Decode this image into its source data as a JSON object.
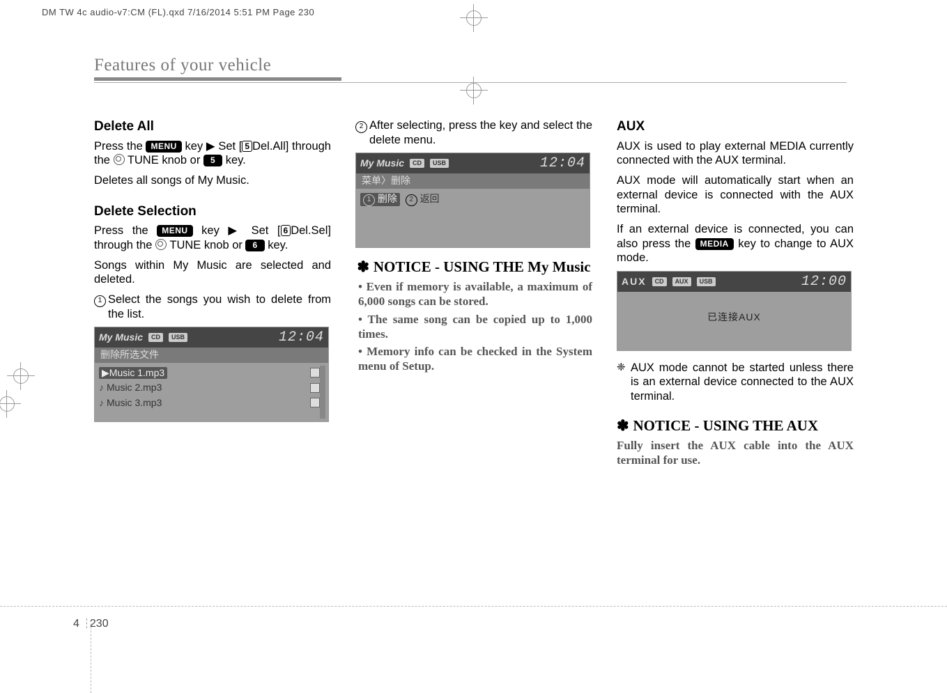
{
  "meta": {
    "print_header": "DM TW 4c audio-v7:CM (FL).qxd  7/16/2014  5:51 PM  Page 230"
  },
  "chapter_title": "Features of your vehicle",
  "footer": {
    "section": "4",
    "page": "230"
  },
  "col1": {
    "h_delete_all": "Delete All",
    "delete_all_1a": "Press the ",
    "key_menu": "MENU",
    "delete_all_1b": " key ▶ Set [",
    "box5": "5",
    "delete_all_1c": "Del.All] through the ",
    "tune": " TUNE knob or ",
    "keynum5": "5",
    "delete_all_1d": " key.",
    "delete_all_2": "Deletes all songs of My Music.",
    "h_delete_sel": "Delete Selection",
    "delete_sel_1a": "Press the ",
    "delete_sel_1b": " key ▶ Set [",
    "box6": "6",
    "delete_sel_1c": "Del.Sel] through the ",
    "keynum6": "6",
    "delete_sel_1d": " key.",
    "delete_sel_2": "Songs within My Music are selected and deleted.",
    "step1_num": "1",
    "step1": "Select the songs you wish to delete from the list.",
    "lcd_title": "My Music",
    "lcd_time": "12:04",
    "lcd_cd": "CD",
    "lcd_usb": "USB",
    "lcd_sub": "删除所选文件",
    "songs": [
      "Music 1.mp3",
      "Music 2.mp3",
      "Music 3.mp3"
    ]
  },
  "col2": {
    "step2_num": "2",
    "step2": "After selecting, press the  key and select the delete menu.",
    "lcd_title": "My Music",
    "lcd_time": "12:04",
    "lcd_cd": "CD",
    "lcd_usb": "USB",
    "lcd_sub": "菜单〉删除",
    "opt1_n": "1",
    "opt1_t": "删除",
    "opt2_n": "2",
    "opt2_t": "返回",
    "notice_title_pre": "✽ ",
    "notice_title": "NOTICE - USING THE My Music",
    "bullets": [
      "Even if memory is available, a maximum of 6,000 songs can be stored.",
      "The same song can be copied up to 1,000 times.",
      "Memory info can be checked in the System menu of Setup."
    ]
  },
  "col3": {
    "h_aux": "AUX",
    "p1": "AUX is used to play external MEDIA currently connected with the AUX terminal.",
    "p2": "AUX mode will automatically start when an external device is connected with the AUX terminal.",
    "p3a": "If an external device is connected, you can also press the ",
    "key_media": "MEDIA",
    "p3b": " key to change to AUX mode.",
    "lcd_title": "AUX",
    "lcd_time": "12:00",
    "lcd_cd": "CD",
    "lcd_aux": "AUX",
    "lcd_usb": "USB",
    "lcd_center": "已连接AUX",
    "snow_note": "AUX mode cannot be started unless there is an external device connected to the AUX terminal.",
    "notice2_title_pre": "✽ ",
    "notice2_title": "NOTICE - USING THE AUX",
    "notice2_body": "Fully insert the AUX cable into the AUX terminal for use."
  }
}
